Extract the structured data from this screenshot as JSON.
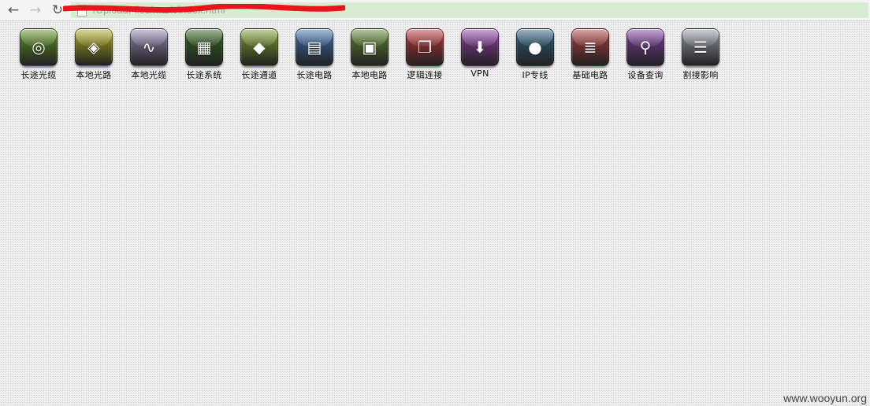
{
  "browser": {
    "back_glyph": "←",
    "forward_glyph": "→",
    "reload_glyph": "↻",
    "url": "/UploadFiles/mark/index.html"
  },
  "apps": [
    {
      "label": "长途光缆",
      "icon": "fiber-globe-icon",
      "color": "#5d8c1e"
    },
    {
      "label": "本地光路",
      "icon": "local-fiber-icon",
      "color": "#a8a61a"
    },
    {
      "label": "本地光缆",
      "icon": "waveform-icon",
      "color": "#8a7fa8"
    },
    {
      "label": "长途系统",
      "icon": "calculator-icon",
      "color": "#2f5f1c"
    },
    {
      "label": "长途通道",
      "icon": "channel-blocks-icon",
      "color": "#7a9a2a"
    },
    {
      "label": "长途电路",
      "icon": "document-id-icon",
      "color": "#3a6aa8"
    },
    {
      "label": "本地电路",
      "icon": "package-icon",
      "color": "#5a7f2a"
    },
    {
      "label": "逻辑连接",
      "icon": "window-link-icon",
      "color": "#b83232"
    },
    {
      "label": "VPN",
      "icon": "vpn-download-icon",
      "color": "#8a3aa0"
    },
    {
      "label": "IP专线",
      "icon": "ip-orb-icon",
      "color": "#2a5a7a"
    },
    {
      "label": "基础电路",
      "icon": "books-icon",
      "color": "#a83a3a"
    },
    {
      "label": "设备查询",
      "icon": "device-search-icon",
      "color": "#7a3a9a"
    },
    {
      "label": "割接影响",
      "icon": "report-sheet-icon",
      "color": "#9090a0"
    }
  ],
  "watermark": "www.wooyun.org"
}
